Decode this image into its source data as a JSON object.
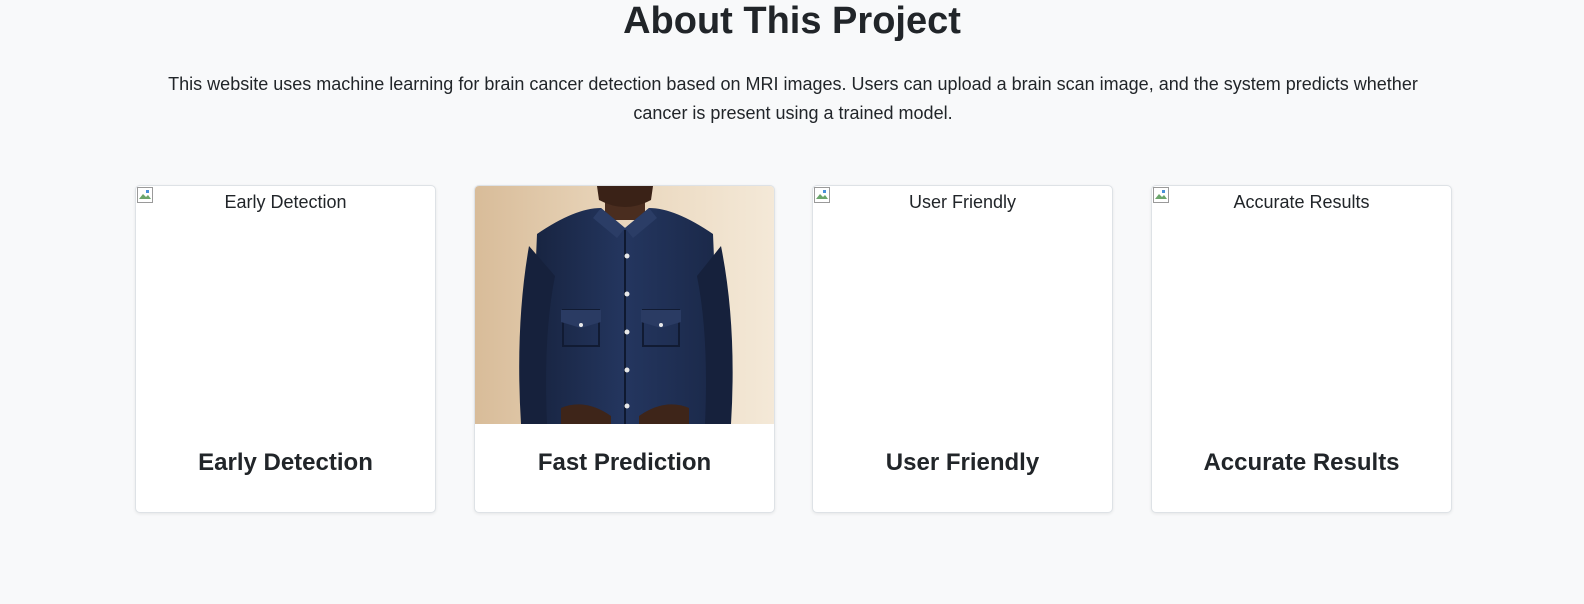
{
  "about": {
    "title": "About This Project",
    "description": "This website uses machine learning for brain cancer detection based on MRI images. Users can upload a brain scan image, and the system predicts whether cancer is present using a trained model."
  },
  "cards": [
    {
      "title": "Early Detection",
      "image_alt": "Early Detection",
      "image_state": "broken"
    },
    {
      "title": "Fast Prediction",
      "image_alt": "",
      "image_state": "photo-person-blue-shirt"
    },
    {
      "title": "User Friendly",
      "image_alt": "User Friendly",
      "image_state": "broken"
    },
    {
      "title": "Accurate Results",
      "image_alt": "Accurate Results",
      "image_state": "broken"
    }
  ],
  "colors": {
    "page_background": "#f8f9fa",
    "card_background": "#ffffff",
    "text": "#212529",
    "card_border": "#dee2e6",
    "shirt": "#1f2f52",
    "photo_background": "#ecd7bd"
  }
}
